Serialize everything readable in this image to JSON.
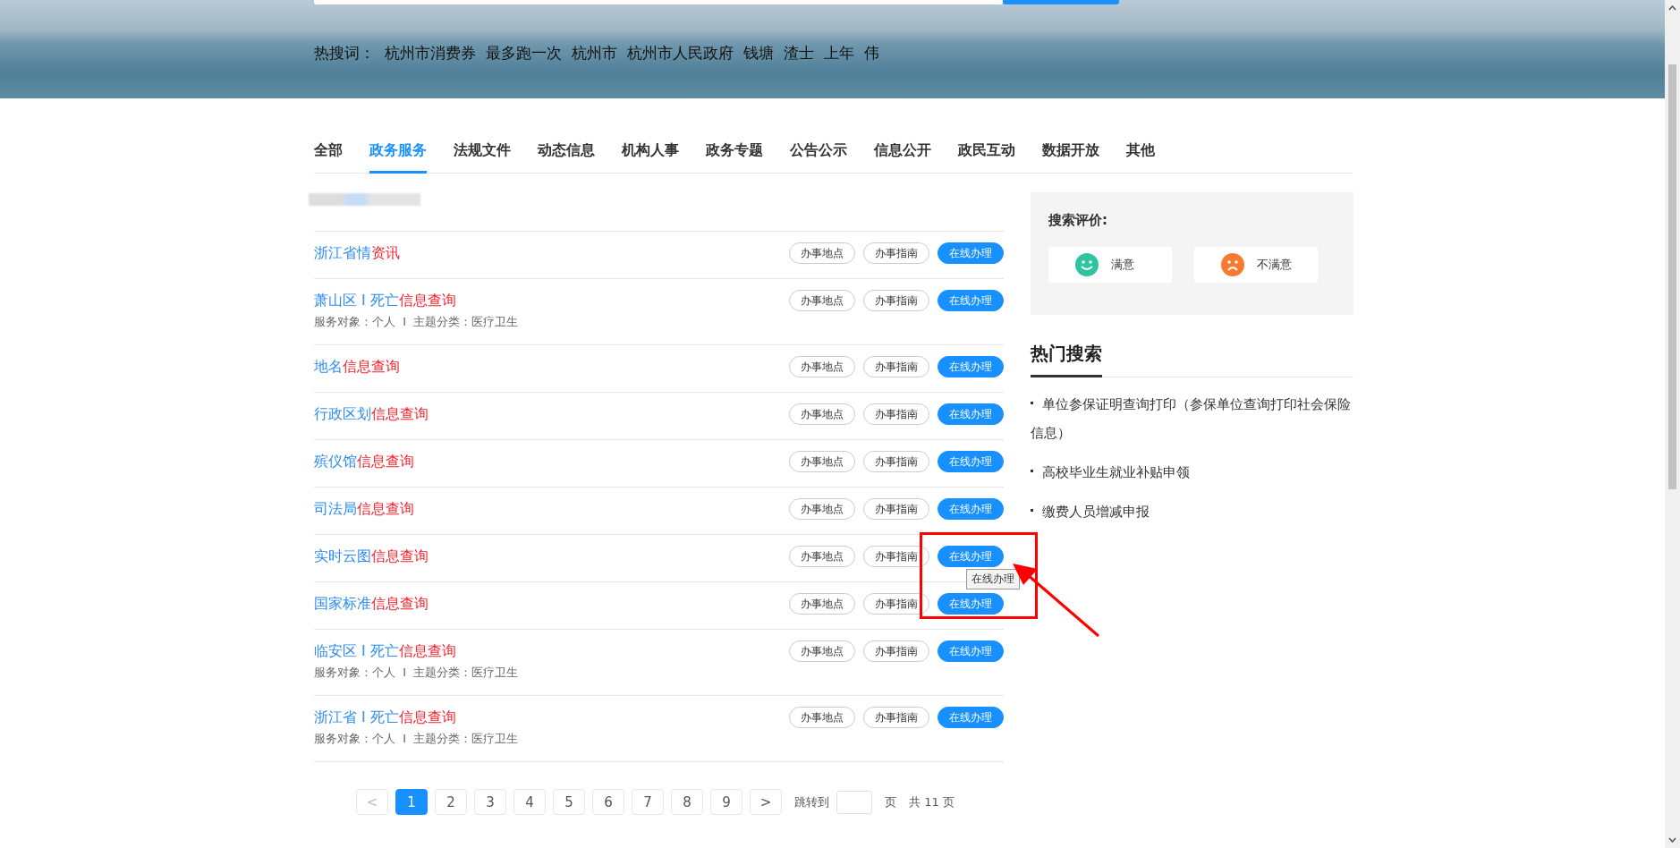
{
  "banner": {
    "hot_label": "热搜词：",
    "hot_terms": [
      "杭州市消费券",
      "最多跑一次",
      "杭州市",
      "杭州市人民政府",
      "钱塘",
      "渣士",
      "上年",
      "伟"
    ]
  },
  "tabs": [
    {
      "label": "全部",
      "selected": false
    },
    {
      "label": "政务服务",
      "selected": true
    },
    {
      "label": "法规文件",
      "selected": false
    },
    {
      "label": "动态信息",
      "selected": false
    },
    {
      "label": "机构人事",
      "selected": false
    },
    {
      "label": "政务专题",
      "selected": false
    },
    {
      "label": "公告公示",
      "selected": false
    },
    {
      "label": "信息公开",
      "selected": false
    },
    {
      "label": "政民互动",
      "selected": false
    },
    {
      "label": "数据开放",
      "selected": false
    },
    {
      "label": "其他",
      "selected": false
    }
  ],
  "results": [
    {
      "name": "浙江省情",
      "highlight": "资讯",
      "actions": [
        {
          "label": "办事地点",
          "kind": "outline"
        },
        {
          "label": "办事指南",
          "kind": "outline"
        },
        {
          "label": "在线办理",
          "kind": "primary"
        }
      ]
    },
    {
      "name": "萧山区 I 死亡",
      "highlight": "信息查询",
      "meta": "服务对象：个人  I  主题分类：医疗卫生",
      "actions": [
        {
          "label": "办事地点",
          "kind": "outline"
        },
        {
          "label": "办事指南",
          "kind": "outline"
        },
        {
          "label": "在线办理",
          "kind": "primary"
        }
      ]
    },
    {
      "name": "地名",
      "highlight": "信息查询",
      "actions": [
        {
          "label": "办事地点",
          "kind": "outline"
        },
        {
          "label": "办事指南",
          "kind": "outline"
        },
        {
          "label": "在线办理",
          "kind": "primary"
        }
      ]
    },
    {
      "name": "行政区划",
      "highlight": "信息查询",
      "actions": [
        {
          "label": "办事地点",
          "kind": "outline"
        },
        {
          "label": "办事指南",
          "kind": "outline"
        },
        {
          "label": "在线办理",
          "kind": "primary"
        }
      ]
    },
    {
      "name": "殡仪馆",
      "highlight": "信息查询",
      "actions": [
        {
          "label": "办事地点",
          "kind": "outline"
        },
        {
          "label": "办事指南",
          "kind": "outline"
        },
        {
          "label": "在线办理",
          "kind": "primary"
        }
      ]
    },
    {
      "name": "司法局",
      "highlight": "信息查询",
      "actions": [
        {
          "label": "办事地点",
          "kind": "outline"
        },
        {
          "label": "办事指南",
          "kind": "outline"
        },
        {
          "label": "在线办理",
          "kind": "primary"
        }
      ]
    },
    {
      "name": "实时云图",
      "highlight": "信息查询",
      "tooltip": "在线办理",
      "actions": [
        {
          "label": "办事地点",
          "kind": "outline"
        },
        {
          "label": "办事指南",
          "kind": "outline"
        },
        {
          "label": "在线办理",
          "kind": "primary"
        }
      ]
    },
    {
      "name": "国家标准",
      "highlight": "信息查询",
      "actions": [
        {
          "label": "办事地点",
          "kind": "outline"
        },
        {
          "label": "办事指南",
          "kind": "outline"
        },
        {
          "label": "在线办理",
          "kind": "primary"
        }
      ]
    },
    {
      "name": "临安区 I 死亡",
      "highlight": "信息查询",
      "meta": "服务对象：个人  I  主题分类：医疗卫生",
      "actions": [
        {
          "label": "办事地点",
          "kind": "outline"
        },
        {
          "label": "办事指南",
          "kind": "outline"
        },
        {
          "label": "在线办理",
          "kind": "primary"
        }
      ]
    },
    {
      "name": "浙江省 I 死亡",
      "highlight": "信息查询",
      "meta": "服务对象：个人  I  主题分类：医疗卫生",
      "actions": [
        {
          "label": "办事地点",
          "kind": "outline"
        },
        {
          "label": "办事指南",
          "kind": "outline"
        },
        {
          "label": "在线办理",
          "kind": "primary"
        }
      ]
    }
  ],
  "pagination": {
    "prev": "<",
    "pages": [
      {
        "label": "1",
        "selected": true
      },
      {
        "label": "2",
        "selected": false
      },
      {
        "label": "3",
        "selected": false
      },
      {
        "label": "4",
        "selected": false
      },
      {
        "label": "5",
        "selected": false
      },
      {
        "label": "6",
        "selected": false
      },
      {
        "label": "7",
        "selected": false
      },
      {
        "label": "8",
        "selected": false
      },
      {
        "label": "9",
        "selected": false
      }
    ],
    "next": ">",
    "jump_label": "跳转到",
    "page_unit": "页",
    "total": "共 11 页"
  },
  "rating": {
    "title": "搜索评价:",
    "options": [
      {
        "label": "满意",
        "kind": "happy"
      },
      {
        "label": "不满意",
        "kind": "sad"
      }
    ]
  },
  "hot_search": {
    "title": "热门搜索",
    "items": [
      "单位参保证明查询打印（参保单位查询打印社会保险信息）",
      "高校毕业生就业补贴申领",
      "缴费人员增减申报"
    ]
  }
}
